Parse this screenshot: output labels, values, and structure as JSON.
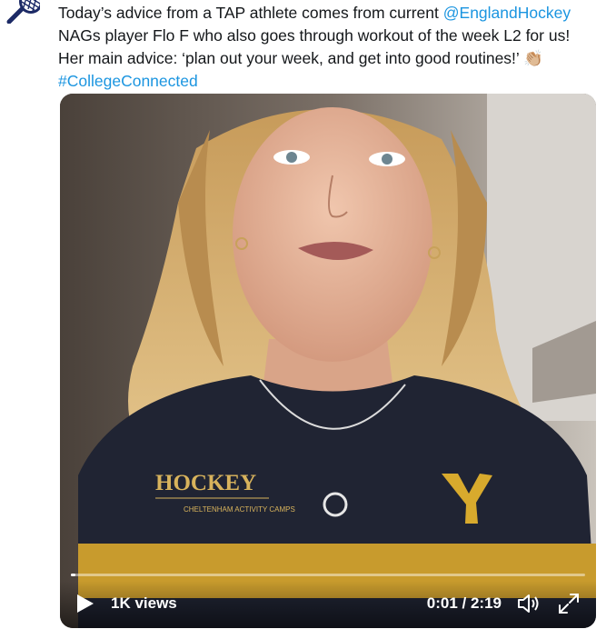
{
  "avatar": {
    "icon": "hockey-stick-icon",
    "color": "#1c2a66"
  },
  "tweet": {
    "line1_pre": "Today’s advice from a TAP athlete comes from current ",
    "mention": "@EnglandHockey",
    "line2": "NAGs player Flo F who also goes through workout of the week L2 for us!",
    "line3_pre": "Her main advice: ‘plan out your week, and get into good routines!’ ",
    "emoji": "👏🏼",
    "hashtag": "#CollegeConnected",
    "link_color": "#1b95e0"
  },
  "video": {
    "shirt_text": "HOCKEY",
    "shirt_subtext": "CHELTENHAM ACTIVITY CAMPS",
    "views": "1K views",
    "time": "0:01 / 2:19",
    "progress": 0.008
  },
  "icons": {
    "play": "play-icon",
    "volume": "volume-icon",
    "fullscreen": "fullscreen-icon"
  }
}
